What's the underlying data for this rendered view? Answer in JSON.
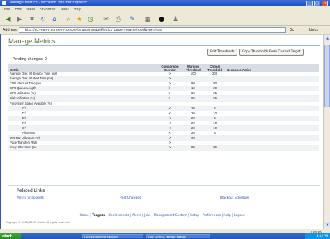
{
  "window": {
    "title": "Manage Metrics - Microsoft Internet Explorer"
  },
  "menu": [
    "File",
    "Edit",
    "View",
    "Favorites",
    "Tools",
    "Help"
  ],
  "address": {
    "label": "Address",
    "url": "http://cc.yourco.com/em/console/target/manageMetrics?target=oracle.host&type=host",
    "go": "Go",
    "links": "Links"
  },
  "page": {
    "title": "Manage Metrics",
    "buttons": {
      "edit": "Edit Thresholds",
      "copy": "Copy Thresholds From Current Target"
    },
    "pending_label": "Pending changes:",
    "pending_value": "0"
  },
  "table": {
    "headers": [
      "Metric",
      "Comparison Operator",
      "Warning Threshold",
      "Critical Threshold",
      "Response Action"
    ],
    "rows": [
      {
        "metric": "Average Disk I/O Service Time (ms)",
        "op": ">",
        "warn": "100",
        "crit": "200",
        "indent": false
      },
      {
        "metric": "Average Disk I/O Wait Time (ms)",
        "op": ">",
        "warn": "",
        "crit": "",
        "indent": false
      },
      {
        "metric": "CPU Interrupt Time (%)",
        "op": ">",
        "warn": "80",
        "crit": "90",
        "indent": false
      },
      {
        "metric": "CPU Queue Length",
        "op": ">",
        "warn": "10",
        "crit": "20",
        "indent": false
      },
      {
        "metric": "CPU Utilization (%)",
        "op": ">",
        "warn": "80",
        "crit": "95",
        "indent": false
      },
      {
        "metric": "Disk Utilization (%)",
        "op": ">",
        "warn": "80",
        "crit": "95",
        "indent": false
      },
      {
        "metric": "Filesystem Space Available (%)",
        "op": "",
        "warn": "",
        "crit": "",
        "indent": false
      },
      {
        "metric": "C:\\",
        "op": "<",
        "warn": "20",
        "crit": "5",
        "indent": true
      },
      {
        "metric": "D:\\",
        "op": "<",
        "warn": "20",
        "crit": "10",
        "indent": true
      },
      {
        "metric": "E:\\",
        "op": "<",
        "warn": "20",
        "crit": "5",
        "indent": true
      },
      {
        "metric": "F:\\",
        "op": "<",
        "warn": "20",
        "crit": "10",
        "indent": true
      },
      {
        "metric": "G:\\",
        "op": "<",
        "warn": "20",
        "crit": "10",
        "indent": true
      },
      {
        "metric": "All others",
        "op": "<",
        "warn": "20",
        "crit": "5",
        "indent": true
      },
      {
        "metric": "Memory Utilization (%)",
        "op": ">",
        "warn": "99",
        "crit": "",
        "indent": false
      },
      {
        "metric": "Page Transfers Rate",
        "op": ">",
        "warn": "",
        "crit": "",
        "indent": false
      },
      {
        "metric": "Swap Utilization (%)",
        "op": ">",
        "warn": "80",
        "crit": "95",
        "indent": false
      }
    ]
  },
  "related": {
    "title": "Related Links",
    "links": [
      "Metric Snapshots",
      "Past Changes",
      "Blackout Schedule"
    ]
  },
  "footer": {
    "nav": [
      "Home",
      "Targets",
      "Deployments",
      "Alerts",
      "Jobs",
      "Management System",
      "Setup",
      "Preferences",
      "Help",
      "Logout"
    ],
    "active": "Targets",
    "copyright": "Copyright © 1996, 2005, Oracle. All rights reserved."
  },
  "status": {
    "zone": "Internet"
  },
  "taskbar": {
    "start": "start",
    "tasks": [
      "Oracle Enterprise Manager",
      "Grid Control - Manage Metrics"
    ],
    "clock": "4:12 PM"
  }
}
